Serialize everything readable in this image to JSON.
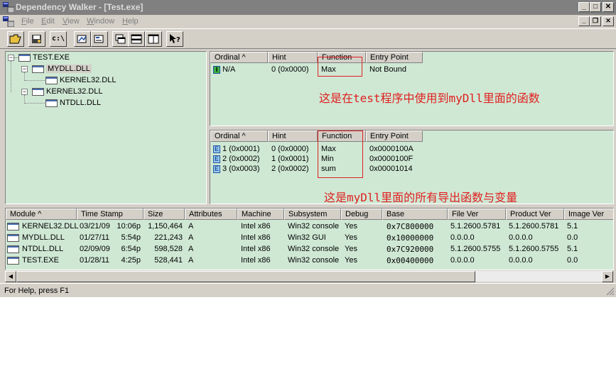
{
  "window": {
    "title": "Dependency Walker - [Test.exe]"
  },
  "menu": [
    {
      "label": "File",
      "key": "F",
      "rest": "ile"
    },
    {
      "label": "Edit",
      "key": "E",
      "rest": "dit"
    },
    {
      "label": "View",
      "key": "V",
      "rest": "iew"
    },
    {
      "label": "Window",
      "key": "W",
      "rest": "indow"
    },
    {
      "label": "Help",
      "key": "H",
      "rest": "elp"
    }
  ],
  "toolbar": {
    "cpath_label": "c:\\",
    "help_label": "?"
  },
  "tree": [
    {
      "label": "TEST.EXE"
    },
    {
      "label": "MYDLL.DLL"
    },
    {
      "label": "KERNEL32.DLL"
    },
    {
      "label": "KERNEL32.DLL"
    },
    {
      "label": "NTDLL.DLL"
    }
  ],
  "imports": {
    "headers": [
      "Ordinal ^",
      "Hint",
      "Function",
      "Entry Point"
    ],
    "rows": [
      {
        "badge": "I",
        "ordinal": "N/A",
        "hint": "0  (0x0000)",
        "function": "Max",
        "entry": "Not Bound"
      }
    ]
  },
  "exports": {
    "headers": [
      "Ordinal ^",
      "Hint",
      "Function",
      "Entry Point"
    ],
    "rows": [
      {
        "badge": "E",
        "ordinal": "1  (0x0001)",
        "hint": "0  (0x0000)",
        "function": "Max",
        "entry": "0x0000100A"
      },
      {
        "badge": "E",
        "ordinal": "2  (0x0002)",
        "hint": "1  (0x0001)",
        "function": "Min",
        "entry": "0x0000100F"
      },
      {
        "badge": "E",
        "ordinal": "3  (0x0003)",
        "hint": "2  (0x0002)",
        "function": "sum",
        "entry": "0x00001014"
      }
    ]
  },
  "annotations": {
    "imports_note": "这是在test程序中使用到myDll里面的函数",
    "exports_note": "这是myDll里面的所有导出函数与变量"
  },
  "modules": {
    "headers": [
      "Module ^",
      "Time Stamp",
      "Size",
      "Attributes",
      "Machine",
      "Subsystem",
      "Debug",
      "Base",
      "File Ver",
      "Product Ver",
      "Image Ver"
    ],
    "rows": [
      {
        "module": "KERNEL32.DLL",
        "date": "03/21/09",
        "time": "10:06p",
        "size": "1,150,464",
        "attr": "A",
        "machine": "Intel x86",
        "subsystem": "Win32 console",
        "debug": "Yes",
        "base": "0x7C800000",
        "filever": "5.1.2600.5781",
        "prodver": "5.1.2600.5781",
        "imgver": "5.1"
      },
      {
        "module": "MYDLL.DLL",
        "date": "01/27/11",
        "time": "5:54p",
        "size": "221,243",
        "attr": "A",
        "machine": "Intel x86",
        "subsystem": "Win32 GUI",
        "debug": "Yes",
        "base": "0x10000000",
        "filever": "0.0.0.0",
        "prodver": "0.0.0.0",
        "imgver": "0.0"
      },
      {
        "module": "NTDLL.DLL",
        "date": "02/09/09",
        "time": "6:54p",
        "size": "598,528",
        "attr": "A",
        "machine": "Intel x86",
        "subsystem": "Win32 console",
        "debug": "Yes",
        "base": "0x7C920000",
        "filever": "5.1.2600.5755",
        "prodver": "5.1.2600.5755",
        "imgver": "5.1"
      },
      {
        "module": "TEST.EXE",
        "date": "01/28/11",
        "time": "4:25p",
        "size": "528,441",
        "attr": "A",
        "machine": "Intel x86",
        "subsystem": "Win32 console",
        "debug": "Yes",
        "base": "0x00400000",
        "filever": "0.0.0.0",
        "prodver": "0.0.0.0",
        "imgver": "0.0"
      }
    ]
  },
  "status": {
    "text": "For Help, press F1"
  },
  "colors": {
    "pane_bg": "#cfe8d4",
    "chrome": "#d4d0c8",
    "titlebar_inactive": "#808080",
    "annotation_red": "#e02020"
  }
}
